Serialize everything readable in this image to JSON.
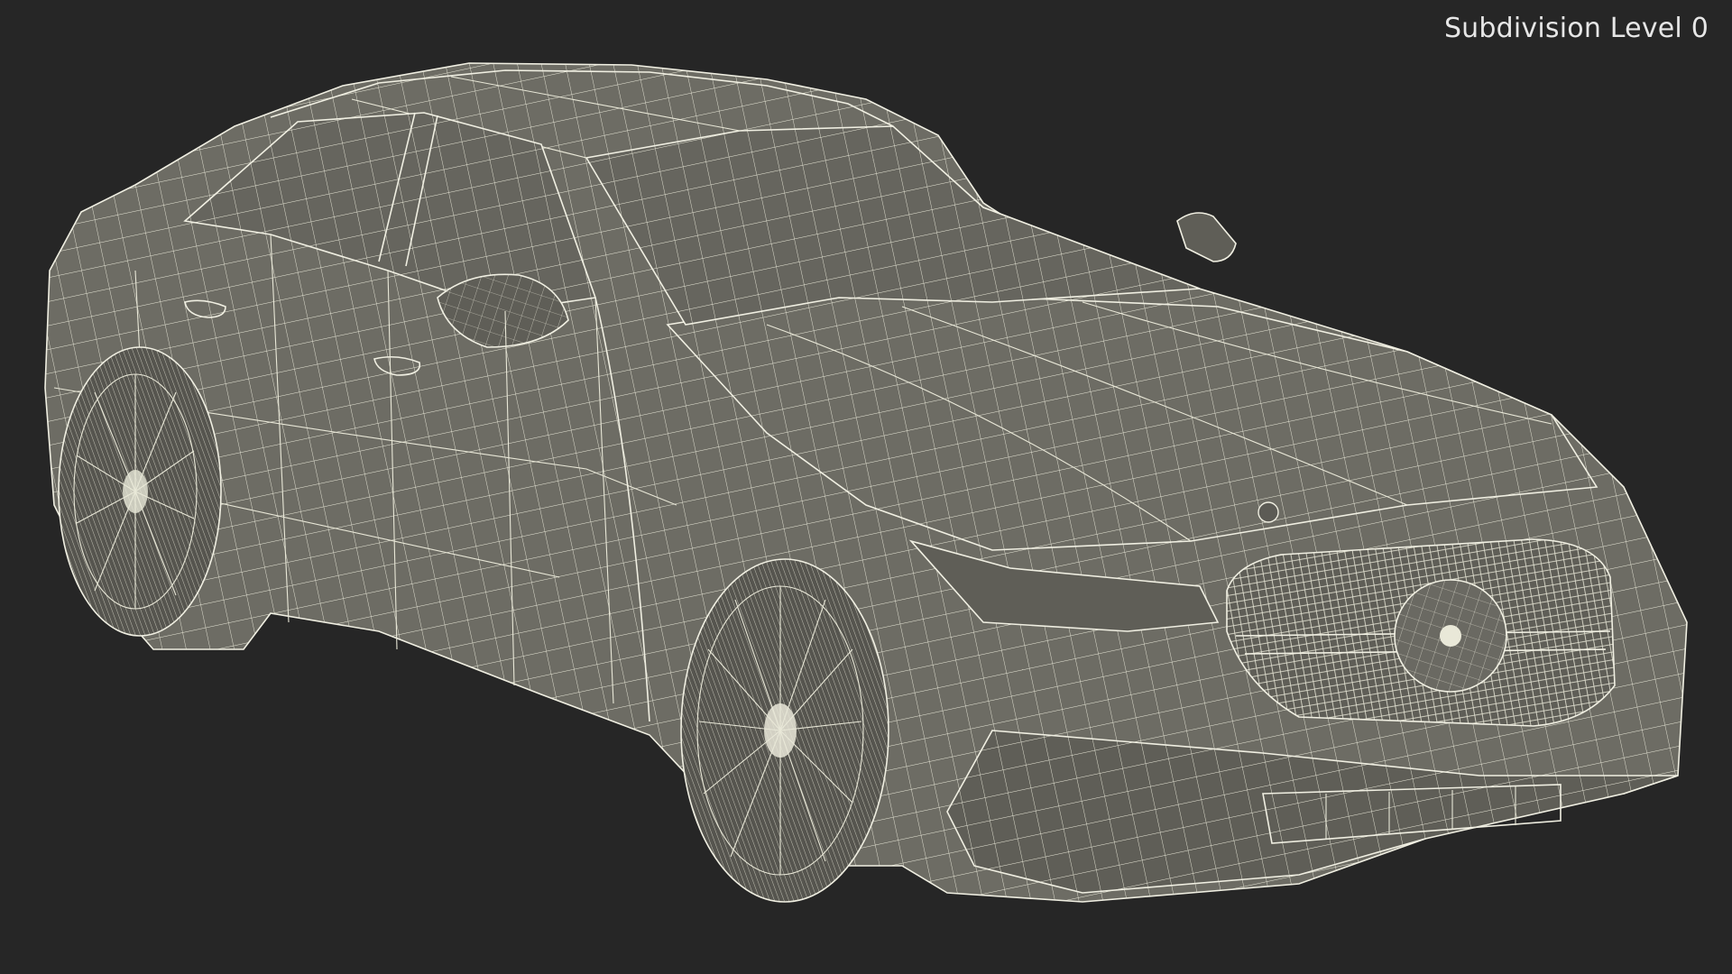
{
  "viewport": {
    "label": "Subdivision Level 0",
    "background_color": "#262626"
  },
  "model": {
    "mesh_color": "#6d6c64",
    "wire_color": "#e9e8d8"
  }
}
